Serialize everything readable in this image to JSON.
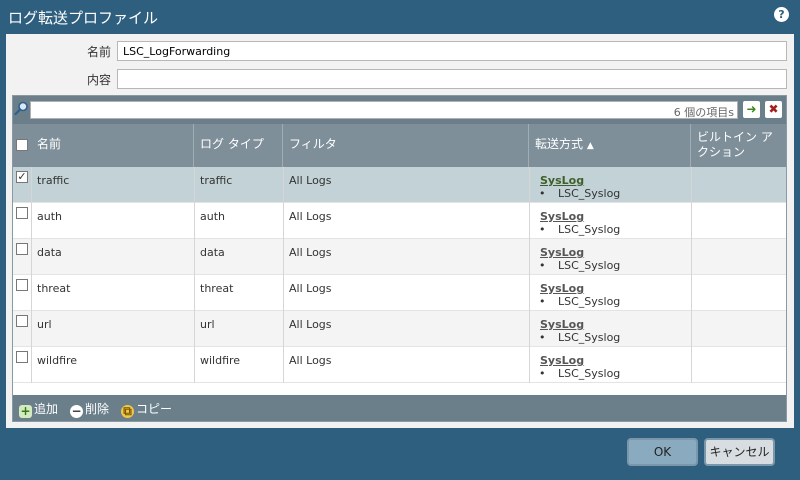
{
  "window": {
    "title": "ログ転送プロファイル",
    "help_icon": "?"
  },
  "form": {
    "name_label": "名前",
    "name_value": "LSC_LogForwarding",
    "description_label": "内容",
    "description_value": ""
  },
  "search": {
    "count_text": "6 個の項目s",
    "go_icon": "➜",
    "clear_icon": "✖"
  },
  "table": {
    "columns": {
      "name": "名前",
      "log_type": "ログ タイプ",
      "filter": "フィルタ",
      "forward": "転送方式",
      "builtin": "ビルトイン アクション"
    },
    "sort_indicator": "▲",
    "rows": [
      {
        "name": "traffic",
        "log_type": "traffic",
        "filter": "All Logs",
        "method": "SysLog",
        "target": "LSC_Syslog",
        "checked": true,
        "selected": true
      },
      {
        "name": "auth",
        "log_type": "auth",
        "filter": "All Logs",
        "method": "SysLog",
        "target": "LSC_Syslog",
        "checked": false,
        "selected": false
      },
      {
        "name": "data",
        "log_type": "data",
        "filter": "All Logs",
        "method": "SysLog",
        "target": "LSC_Syslog",
        "checked": false,
        "selected": false
      },
      {
        "name": "threat",
        "log_type": "threat",
        "filter": "All Logs",
        "method": "SysLog",
        "target": "LSC_Syslog",
        "checked": false,
        "selected": false
      },
      {
        "name": "url",
        "log_type": "url",
        "filter": "All Logs",
        "method": "SysLog",
        "target": "LSC_Syslog",
        "checked": false,
        "selected": false
      },
      {
        "name": "wildfire",
        "log_type": "wildfire",
        "filter": "All Logs",
        "method": "SysLog",
        "target": "LSC_Syslog",
        "checked": false,
        "selected": false
      }
    ]
  },
  "footer": {
    "add": "追加",
    "delete": "削除",
    "copy": "コピー"
  },
  "buttons": {
    "ok": "OK",
    "cancel": "キャンセル"
  },
  "colors": {
    "titlebar": "#2f5f7f",
    "selected_row": "#c3d2d6",
    "grid_header": "#7e8f9a",
    "toolbar": "#6b7f8b"
  }
}
